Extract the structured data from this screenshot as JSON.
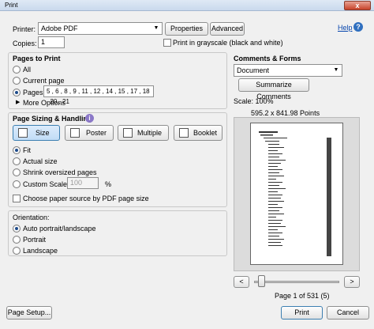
{
  "window": {
    "title": "Print",
    "close_label": "x"
  },
  "printer": {
    "label": "Printer:",
    "value": "Adobe PDF",
    "properties_label": "Properties",
    "advanced_label": "Advanced",
    "help_label": "Help"
  },
  "copies": {
    "label": "Copies:",
    "value": "1",
    "grayscale_label": "Print in grayscale (black and white)"
  },
  "pages_to_print": {
    "title": "Pages to Print",
    "all_label": "All",
    "current_label": "Current page",
    "pages_label": "Pages",
    "pages_value": "5 , 6 , 8 , 9 , 11 , 12 , 14 , 15 , 17 , 18 , 20 , 21",
    "more_options_label": "More Options"
  },
  "sizing": {
    "title": "Page Sizing & Handling",
    "info_icon": "i",
    "buttons": [
      "Size",
      "Poster",
      "Multiple",
      "Booklet"
    ],
    "fit_label": "Fit",
    "actual_label": "Actual size",
    "shrink_label": "Shrink oversized pages",
    "custom_label": "Custom Scale:",
    "custom_value": "100",
    "custom_unit": "%",
    "paper_source_label": "Choose paper source by PDF page size"
  },
  "orientation": {
    "title": "Orientation:",
    "auto_label": "Auto portrait/landscape",
    "portrait_label": "Portrait",
    "landscape_label": "Landscape"
  },
  "comments_forms": {
    "title": "Comments & Forms",
    "value": "Document",
    "summarize_label": "Summarize Comments"
  },
  "preview": {
    "scale_label": "Scale: 100%",
    "dimensions": "595.2 x 841.98 Points",
    "prev_label": "<",
    "next_label": ">",
    "page_status": "Page 1 of 531 (5)"
  },
  "footer": {
    "page_setup_label": "Page Setup...",
    "print_label": "Print",
    "cancel_label": "Cancel"
  },
  "colors": {
    "accent": "#3c7fb1",
    "title_bar": "#c9d9ed"
  }
}
